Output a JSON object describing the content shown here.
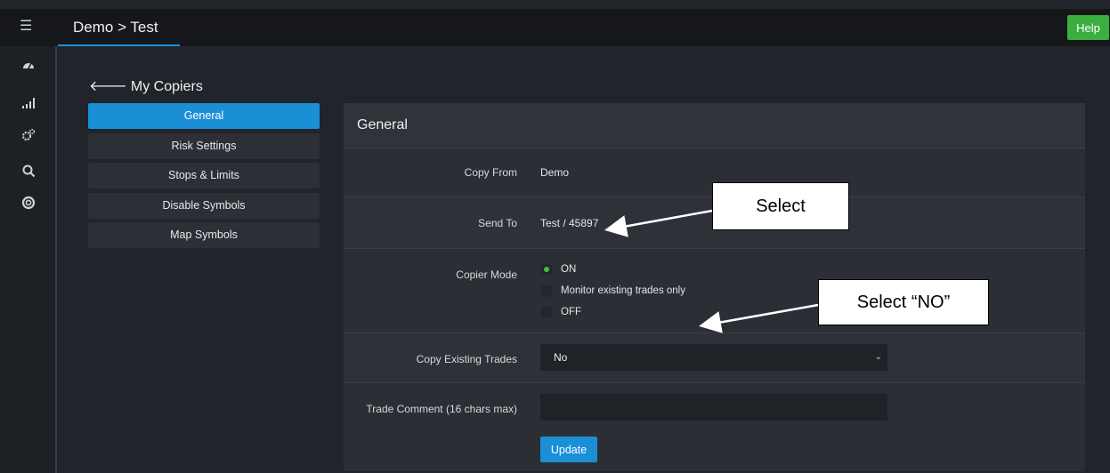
{
  "header": {
    "breadcrumb": "Demo > Test",
    "help_label": "Help",
    "menu_icon": "hamburger-icon"
  },
  "rail": {
    "icons": [
      "dashboard-icon",
      "signal-icon",
      "gears-icon",
      "search-icon",
      "lifebuoy-icon"
    ]
  },
  "sidebar": {
    "back_label": "My Copiers",
    "items": [
      {
        "label": "General",
        "active": true
      },
      {
        "label": "Risk Settings"
      },
      {
        "label": "Stops & Limits"
      },
      {
        "label": "Disable Symbols"
      },
      {
        "label": "Map Symbols"
      }
    ]
  },
  "panel": {
    "title": "General",
    "copy_from": {
      "label": "Copy From",
      "value": "Demo"
    },
    "send_to": {
      "label": "Send To",
      "value": "Test / 45897"
    },
    "copier_mode": {
      "label": "Copier Mode",
      "options": [
        "ON",
        "Monitor existing trades only",
        "OFF"
      ],
      "selected": "ON"
    },
    "copy_existing": {
      "label": "Copy Existing Trades",
      "selected": "No"
    },
    "trade_comment": {
      "label": "Trade Comment (16 chars max)",
      "value": ""
    },
    "update_label": "Update"
  },
  "annotations": {
    "select": "Select",
    "select_no": "Select “NO”"
  },
  "colors": {
    "accent": "#1a8fd6",
    "help_green": "#3cae3f",
    "radio_on": "#3fbf4a"
  }
}
